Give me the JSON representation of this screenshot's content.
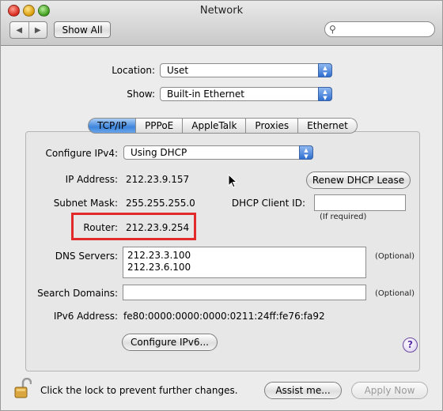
{
  "window": {
    "title": "Network"
  },
  "toolbar": {
    "back_icon": "◀",
    "forward_icon": "▶",
    "show_all": "Show All",
    "search_placeholder": ""
  },
  "location": {
    "label": "Location:",
    "value": "Uset"
  },
  "show": {
    "label": "Show:",
    "value": "Built-in Ethernet"
  },
  "tabs": [
    "TCP/IP",
    "PPPoE",
    "AppleTalk",
    "Proxies",
    "Ethernet"
  ],
  "active_tab": "TCP/IP",
  "configure_ipv4": {
    "label": "Configure IPv4:",
    "value": "Using DHCP"
  },
  "ip_address": {
    "label": "IP Address:",
    "value": "212.23.9.157"
  },
  "renew_button": "Renew DHCP Lease",
  "subnet": {
    "label": "Subnet Mask:",
    "value": "255.255.255.0"
  },
  "dhcp_client": {
    "label": "DHCP Client ID:",
    "value": "",
    "hint": "(If required)"
  },
  "router": {
    "label": "Router:",
    "value": "212.23.9.254"
  },
  "dns": {
    "label": "DNS Servers:",
    "values": [
      "212.23.3.100",
      "212.23.6.100"
    ],
    "hint": "(Optional)"
  },
  "search_domains": {
    "label": "Search Domains:",
    "value": "",
    "hint": "(Optional)"
  },
  "ipv6": {
    "label": "IPv6 Address:",
    "value": "fe80:0000:0000:0000:0211:24ff:fe76:fa92"
  },
  "configure_ipv6_button": "Configure IPv6...",
  "help": "?",
  "footer": {
    "lock_text": "Click the lock to prevent further changes.",
    "assist_button": "Assist me...",
    "apply_button": "Apply Now"
  },
  "colors": {
    "highlight": "#e22a2a",
    "tab_active": "#3e85dc"
  }
}
